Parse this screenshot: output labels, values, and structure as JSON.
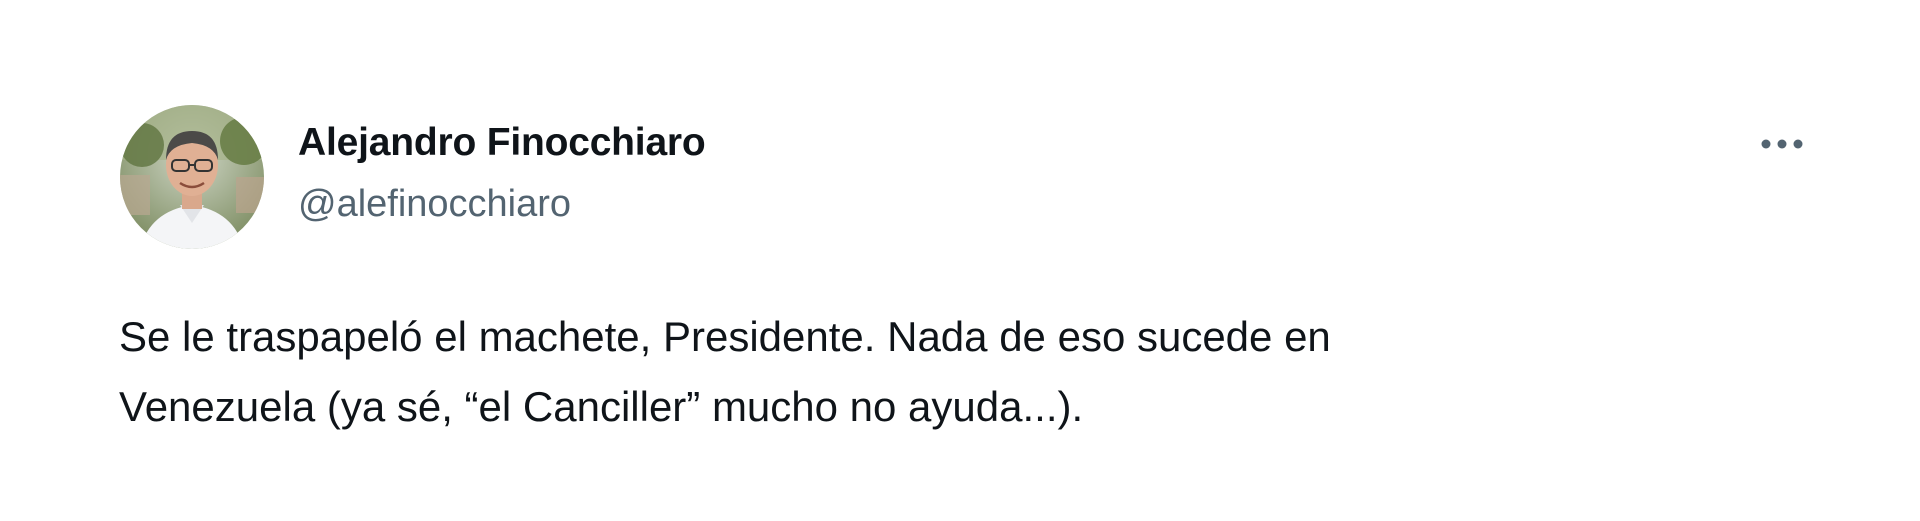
{
  "tweet": {
    "author": {
      "display_name": "Alejandro Finocchiaro",
      "handle": "@alefinocchiaro",
      "avatar": "profile-photo"
    },
    "more_icon": "more-horizontal-icon",
    "text_lines": [
      "Se le traspapeló el machete, Presidente. Nada de eso sucede en",
      "Venezuela (ya sé, “el Canciller” mucho no ayuda...)."
    ]
  },
  "colors": {
    "background": "#ffffff",
    "primary_text": "#0f1419",
    "secondary_text": "#536471"
  }
}
